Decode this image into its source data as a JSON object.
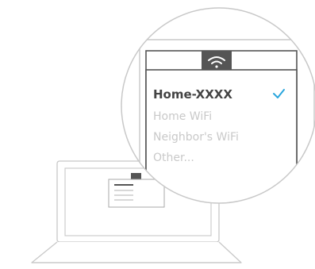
{
  "wifi_menu": {
    "networks": [
      {
        "name": "Home-XXXX",
        "selected": true
      },
      {
        "name": "Home WiFi",
        "selected": false
      },
      {
        "name": "Neighbor's WiFi",
        "selected": false
      },
      {
        "name": "Other...",
        "selected": false
      }
    ]
  },
  "icons": {
    "wifi": "wifi-icon",
    "checkmark": "checkmark-icon"
  },
  "colors": {
    "line_gray": "#c8c8c8",
    "dark_gray": "#555555",
    "text_dark": "#444444",
    "text_light": "#c9c9c9",
    "accent_blue": "#2aa6dd"
  }
}
